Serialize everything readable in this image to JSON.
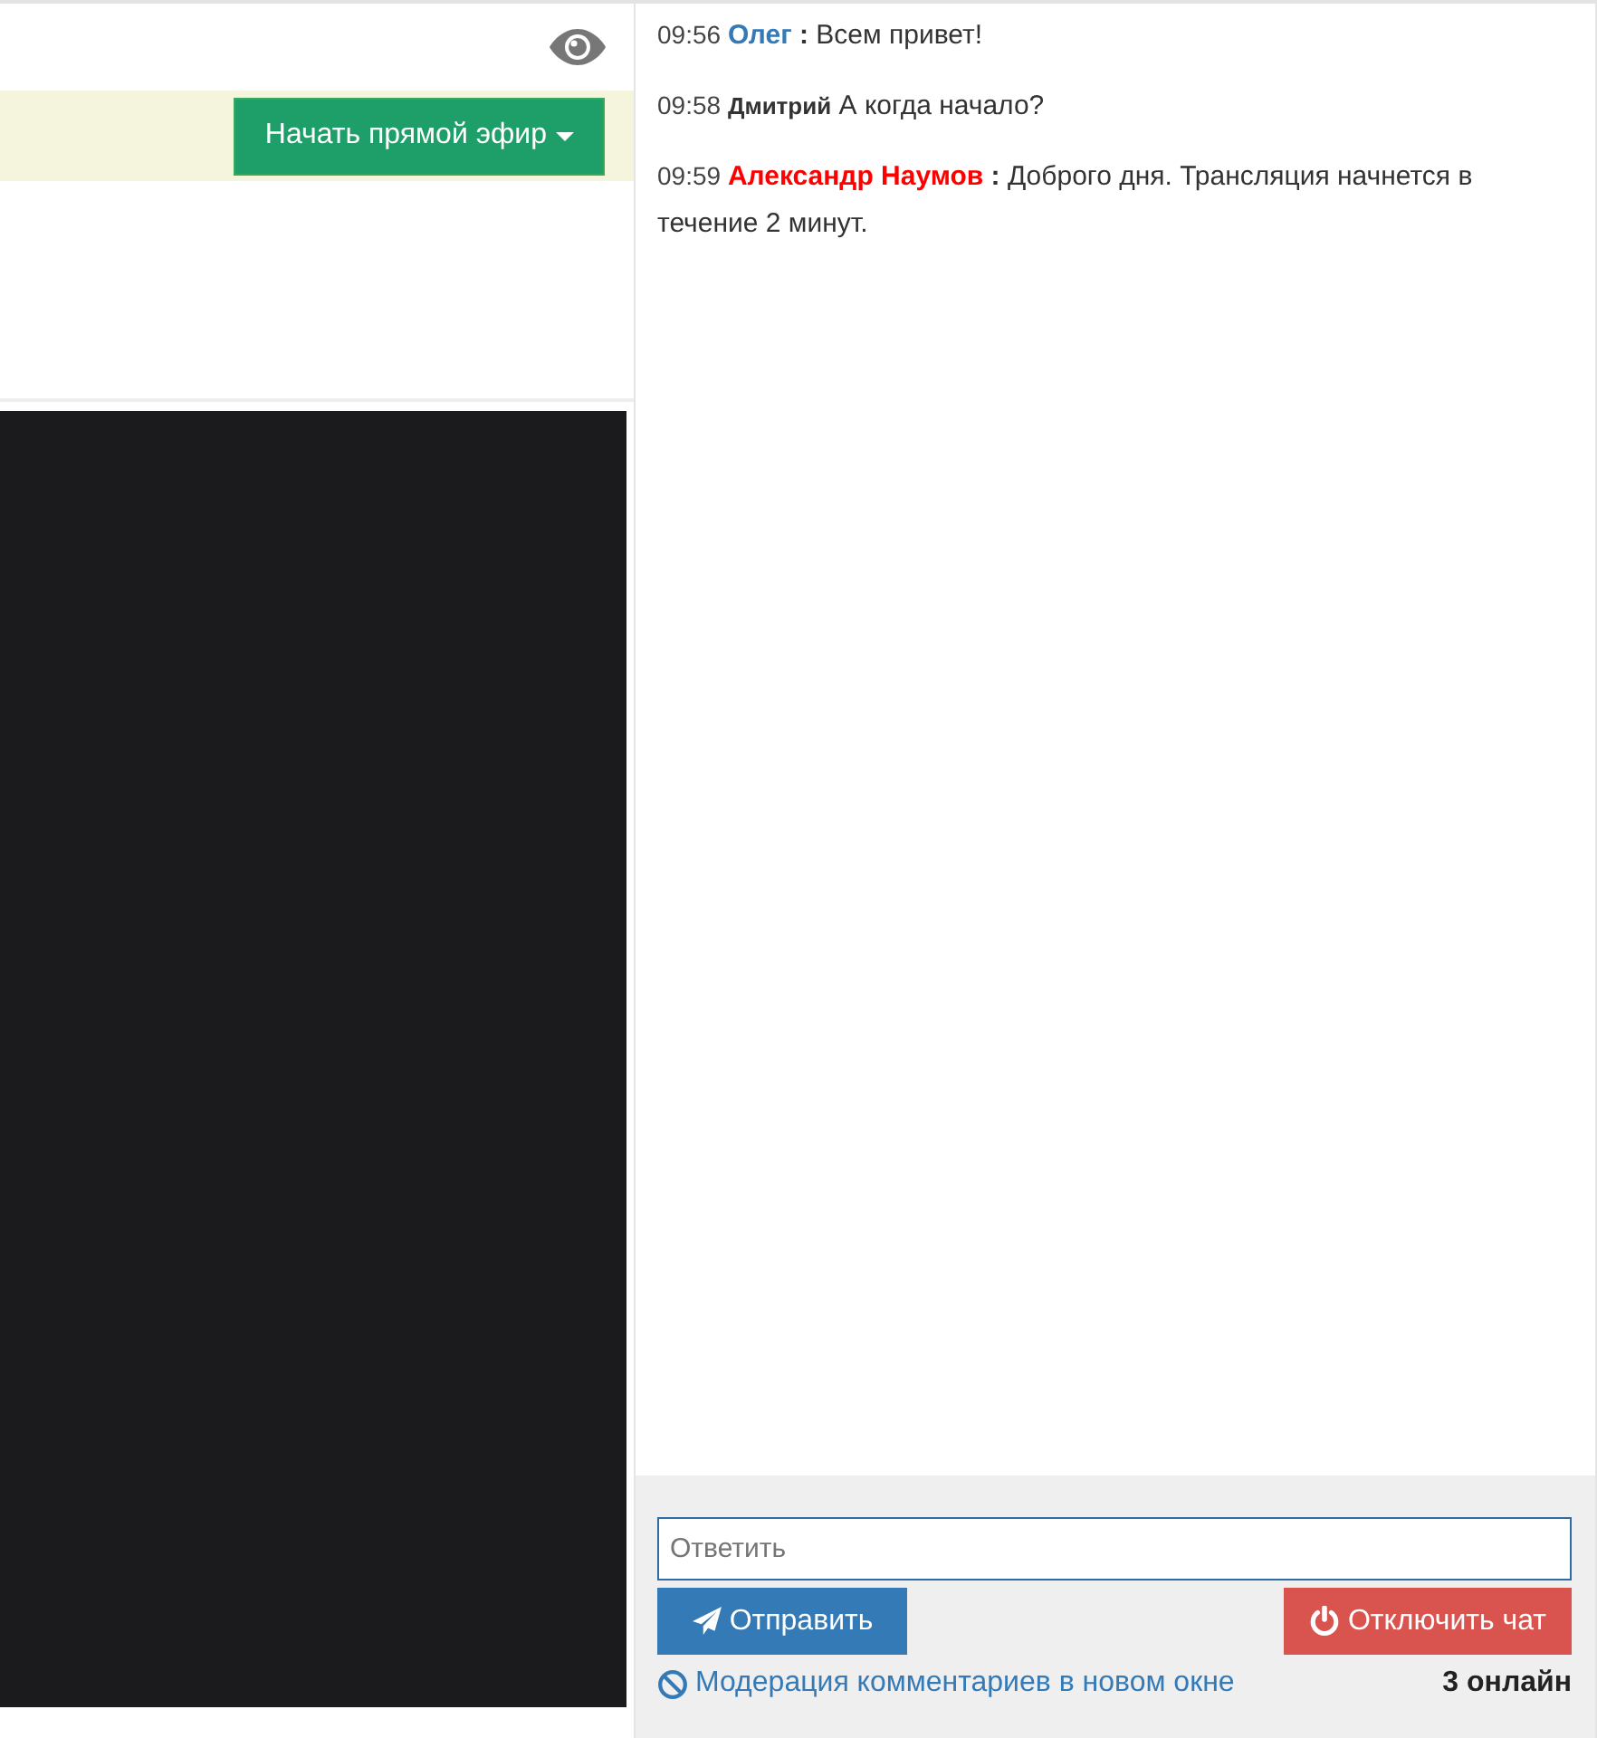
{
  "broadcast": {
    "start_button": {
      "label": "Начать прямой эфир"
    }
  },
  "chat": {
    "messages": [
      {
        "time": "09:56",
        "author": "Олег",
        "separator": ":",
        "text": "Всем привет!",
        "kind": "named",
        "color": "#337ab7"
      },
      {
        "time": "09:58",
        "author": "Дмитрий",
        "text": "А когда начало?",
        "kind": "guest",
        "color": "#333333"
      },
      {
        "time": "09:59",
        "author": "Александр Наумов",
        "separator": ":",
        "text": "Доброго дня. Трансляция начнется в течение 2 минут.",
        "kind": "named",
        "color": "#ff0000"
      }
    ],
    "reply": {
      "placeholder": "Ответить"
    },
    "send_button": {
      "label": "Отправить"
    },
    "disable_button": {
      "label": "Отключить чат"
    },
    "moderation_link": "Модерация комментариев в новом окне",
    "online": "3 онлайн"
  }
}
